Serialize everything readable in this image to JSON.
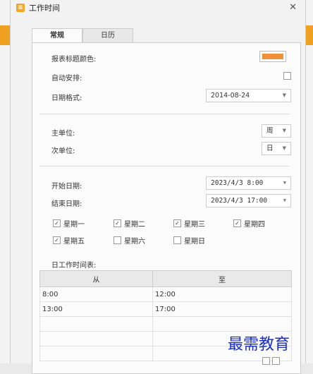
{
  "window": {
    "title": "工作时间",
    "icon": "app-icon",
    "close_glyph": "✕"
  },
  "tabs": [
    {
      "label": "常规",
      "active": true
    },
    {
      "label": "日历",
      "active": false
    }
  ],
  "general": {
    "title_color_label": "报表标题颜色:",
    "title_color_value": "#f0913a",
    "auto_schedule_label": "自动安排:",
    "auto_schedule_checked": false,
    "date_format_label": "日期格式:",
    "date_format_value": "2014-08-24",
    "major_unit_label": "主单位:",
    "major_unit_value": "周",
    "minor_unit_label": "次单位:",
    "minor_unit_value": "日",
    "start_date_label": "开始日期:",
    "start_date_value": "2023/4/3 8:00",
    "end_date_label": "结束日期:",
    "end_date_value": "2023/4/3 17:00"
  },
  "days": [
    {
      "label": "星期一",
      "checked": true
    },
    {
      "label": "星期二",
      "checked": true
    },
    {
      "label": "星期三",
      "checked": true
    },
    {
      "label": "星期四",
      "checked": true
    },
    {
      "label": "星期五",
      "checked": true
    },
    {
      "label": "星期六",
      "checked": false
    },
    {
      "label": "星期日",
      "checked": false
    }
  ],
  "worktime": {
    "label": "日工作时间表:",
    "col_from": "从",
    "col_to": "至",
    "rows": [
      {
        "from": "8:00",
        "to": "12:00"
      },
      {
        "from": "13:00",
        "to": "17:00"
      },
      {
        "from": "",
        "to": ""
      },
      {
        "from": "",
        "to": ""
      },
      {
        "from": "",
        "to": ""
      }
    ]
  },
  "watermark": "最需教育",
  "glyphs": {
    "check": "✓",
    "dropdown_arrow": "▼"
  }
}
